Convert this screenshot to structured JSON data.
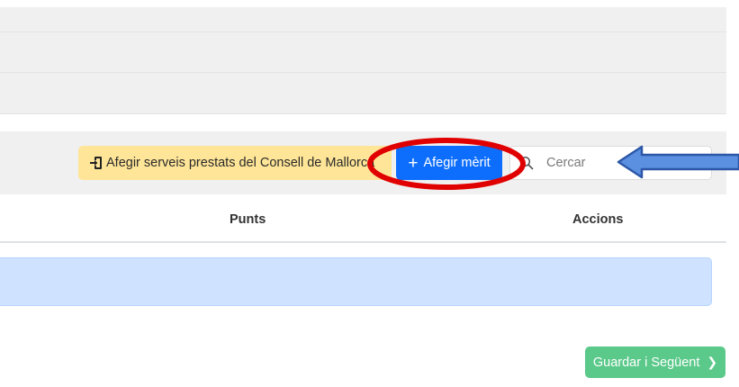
{
  "toolbar": {
    "add_services_label": "Afegir serveis prestats del Consell de Mallorca",
    "add_merit_label": "Afegir mèrit",
    "search_placeholder": "Cercar"
  },
  "table": {
    "headers": [
      "Punts",
      "Accions"
    ]
  },
  "footer": {
    "save_next_label": "Guardar i Següent"
  },
  "colors": {
    "warning": "#ffe597",
    "primary": "#0d6efd",
    "success": "#5bc98a",
    "info_bg": "#cfe2ff",
    "annotation_red": "#e00000",
    "annotation_blue": "#3a6fc9"
  },
  "icons": {
    "add_services": "file-import-icon",
    "add_merit": "plus-icon",
    "search": "search-icon",
    "save_next": "chevron-right-icon"
  }
}
